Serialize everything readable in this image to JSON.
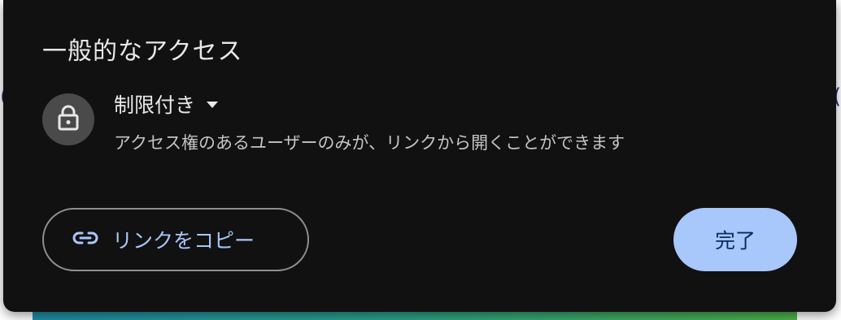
{
  "dialog": {
    "section_title": "一般的なアクセス",
    "access": {
      "icon": "lock-icon",
      "selected": "制限付き",
      "description": "アクセス権のあるユーザーのみが、リンクから開くことができます"
    },
    "buttons": {
      "copy_link": {
        "icon": "link-icon",
        "label": "リンクをコピー"
      },
      "done": {
        "label": "完了"
      }
    }
  },
  "colors": {
    "dialog_bg": "#111111",
    "text_primary": "#e8e8e8",
    "text_secondary": "#c4c4c4",
    "accent": "#a8c7fa",
    "accent_text": "#0b2a5c",
    "outline": "#8f8f8f"
  }
}
